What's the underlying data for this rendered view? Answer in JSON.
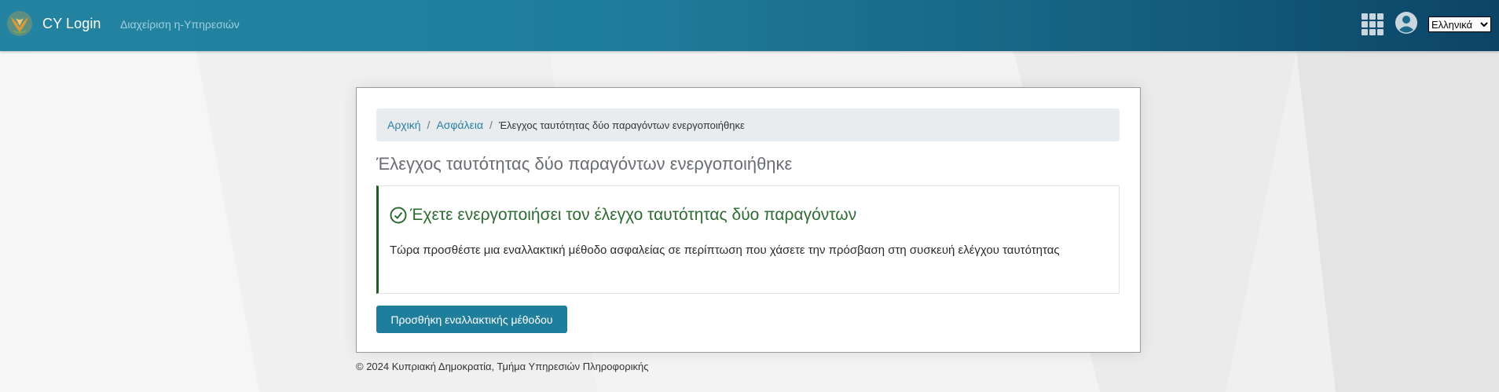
{
  "header": {
    "brand": "CY Login",
    "service_link": "Διαχείριση η-Υπηρεσιών",
    "apps_icon": "apps-grid-icon",
    "user_icon": "user-circle-icon",
    "language": "Ελληνικά"
  },
  "breadcrumb": {
    "items": [
      "Αρχική",
      "Ασφάλεια"
    ],
    "separator": "/",
    "current": "Έλεγχος ταυτότητας δύο παραγόντων ενεργοποιήθηκε"
  },
  "page": {
    "title": "Έλεγχος ταυτότητας δύο παραγόντων ενεργοποιήθηκε",
    "success_heading": "Έχετε ενεργοποιήσει τον έλεγχο ταυτότητας δύο παραγόντων",
    "success_body": "Τώρα προσθέστε μια εναλλακτική μέθοδο ασφαλείας σε περίπτωση που χάσετε την πρόσβαση στη συσκευή ελέγχου ταυτότητας",
    "add_method_button": "Προσθήκη εναλλακτικής μέθοδου"
  },
  "footer": {
    "text": "© 2024 Κυπριακή Δημοκρατία, Τμήμα Υπηρεσιών Πληροφορικής"
  },
  "colors": {
    "header_start": "#2383a0",
    "header_end": "#0c4466",
    "accent": "#1f7e9c",
    "success": "#2e6b33"
  }
}
